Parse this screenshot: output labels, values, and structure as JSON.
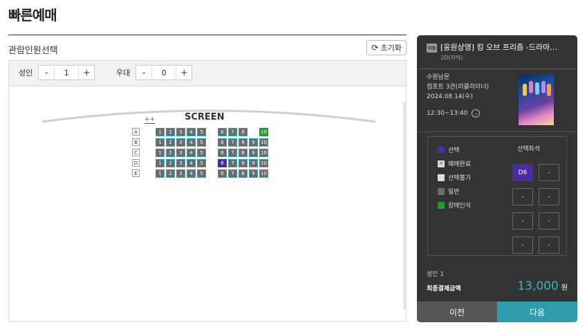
{
  "page_title": "빠른예매",
  "section_title": "관람인원선택",
  "reset_label": "초기화",
  "people": {
    "adult_label": "성인",
    "adult_value": "1",
    "senior_label": "우대",
    "senior_value": "0",
    "minus": "-",
    "plus": "+"
  },
  "screen_label": "SCREEN",
  "exit_icon_text": "++",
  "rows": [
    {
      "label": "A",
      "seats": [
        {
          "num": "1",
          "status": "general"
        },
        {
          "num": "2",
          "status": "general"
        },
        {
          "num": "3",
          "status": "general"
        },
        {
          "num": "4",
          "status": "general"
        },
        {
          "num": "5",
          "status": "general"
        },
        {
          "num": "6",
          "status": "general"
        },
        {
          "num": "7",
          "status": "general"
        },
        {
          "num": "8",
          "status": "general"
        },
        {
          "num": "10",
          "status": "disabled"
        }
      ]
    },
    {
      "label": "B",
      "seats": [
        {
          "num": "1",
          "status": "general"
        },
        {
          "num": "2",
          "status": "general"
        },
        {
          "num": "3",
          "status": "general"
        },
        {
          "num": "4",
          "status": "general"
        },
        {
          "num": "5",
          "status": "general"
        },
        {
          "num": "6",
          "status": "general"
        },
        {
          "num": "7",
          "status": "general"
        },
        {
          "num": "8",
          "status": "general"
        },
        {
          "num": "9",
          "status": "general"
        },
        {
          "num": "10",
          "status": "general"
        }
      ]
    },
    {
      "label": "C",
      "seats": [
        {
          "num": "1",
          "status": "general"
        },
        {
          "num": "2",
          "status": "general"
        },
        {
          "num": "3",
          "status": "general"
        },
        {
          "num": "4",
          "status": "general"
        },
        {
          "num": "5",
          "status": "general"
        },
        {
          "num": "6",
          "status": "general"
        },
        {
          "num": "7",
          "status": "general"
        },
        {
          "num": "8",
          "status": "general"
        },
        {
          "num": "9",
          "status": "general"
        },
        {
          "num": "10",
          "status": "general"
        }
      ]
    },
    {
      "label": "D",
      "seats": [
        {
          "num": "1",
          "status": "general"
        },
        {
          "num": "2",
          "status": "general"
        },
        {
          "num": "3",
          "status": "general"
        },
        {
          "num": "4",
          "status": "general"
        },
        {
          "num": "5",
          "status": "general"
        },
        {
          "num": "6",
          "status": "selected"
        },
        {
          "num": "7",
          "status": "general"
        },
        {
          "num": "8",
          "status": "general"
        },
        {
          "num": "9",
          "status": "general"
        },
        {
          "num": "10",
          "status": "general"
        }
      ]
    },
    {
      "label": "E",
      "seats": [
        {
          "num": "1",
          "status": "general"
        },
        {
          "num": "2",
          "status": "general"
        },
        {
          "num": "3",
          "status": "general"
        },
        {
          "num": "4",
          "status": "general"
        },
        {
          "num": "5",
          "status": "general"
        },
        {
          "num": "6",
          "status": "general"
        },
        {
          "num": "7",
          "status": "general"
        },
        {
          "num": "8",
          "status": "general"
        },
        {
          "num": "9",
          "status": "general"
        },
        {
          "num": "10",
          "status": "general"
        }
      ]
    }
  ],
  "movie": {
    "rating_badge": "미정",
    "title": "[응원상영] 킹 오브 프리즘 -드라마…",
    "format": "2D(자막)",
    "theater": "수원남문",
    "hall": "컴포트 3관(리클라이너)",
    "date": "2024.08.14(수)",
    "time": "12:30~13:40"
  },
  "legend": [
    {
      "key": "selected",
      "label": "선택"
    },
    {
      "key": "reserved",
      "label": "예매완료"
    },
    {
      "key": "unavailable",
      "label": "선택불가"
    },
    {
      "key": "general",
      "label": "일반"
    },
    {
      "key": "disabled",
      "label": "장애인석"
    }
  ],
  "selected_seats_title": "선택좌석",
  "selected_slots": [
    "D6",
    "-",
    "-",
    "-",
    "-",
    "-",
    "-",
    "-"
  ],
  "summary": {
    "adult_count": "성인 1",
    "total_label": "최종결제금액",
    "total_amount": "13,000",
    "total_unit": "원"
  },
  "buttons": {
    "prev": "이전",
    "next": "다음"
  },
  "colors": {
    "accent": "#2d9cad",
    "selected_seat": "#4a2c9c",
    "disabled_seat": "#1f9c2a",
    "general_seat": "#6b6b6b",
    "panel_bg": "#333333"
  }
}
